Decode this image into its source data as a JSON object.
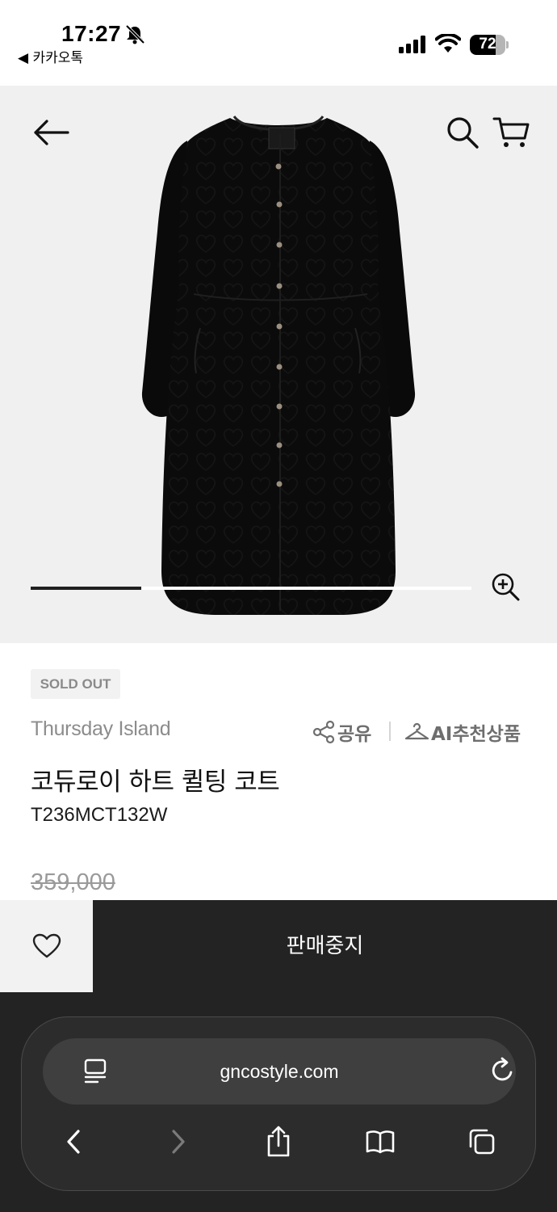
{
  "status_bar": {
    "time": "17:27",
    "back_app": "◀ 카카오톡",
    "battery": "72",
    "battery_level": 0.72
  },
  "header": {
    "back_icon": "arrow-left-icon",
    "search_icon": "search-icon",
    "cart_icon": "cart-icon"
  },
  "gallery": {
    "progress": 0.25,
    "zoom_icon": "zoom-in-icon"
  },
  "product": {
    "badge": "SOLD OUT",
    "brand": "Thursday Island",
    "share_label": "공유",
    "ai_label": "AI추천상품",
    "title": "코듀로이 하트 퀼팅 코트",
    "sku": "T236MCT132W",
    "original_price": "359,000"
  },
  "actions": {
    "wish_icon": "heart-icon",
    "sold_label": "판매중지"
  },
  "browser": {
    "url": "gncostyle.com",
    "nav_icons": [
      "back-icon",
      "forward-icon",
      "share-icon",
      "bookmarks-icon",
      "tabs-icon"
    ]
  },
  "colors": {
    "dark": "#232323",
    "hero_bg": "#f0f0f0",
    "muted": "#8c8c8c"
  }
}
